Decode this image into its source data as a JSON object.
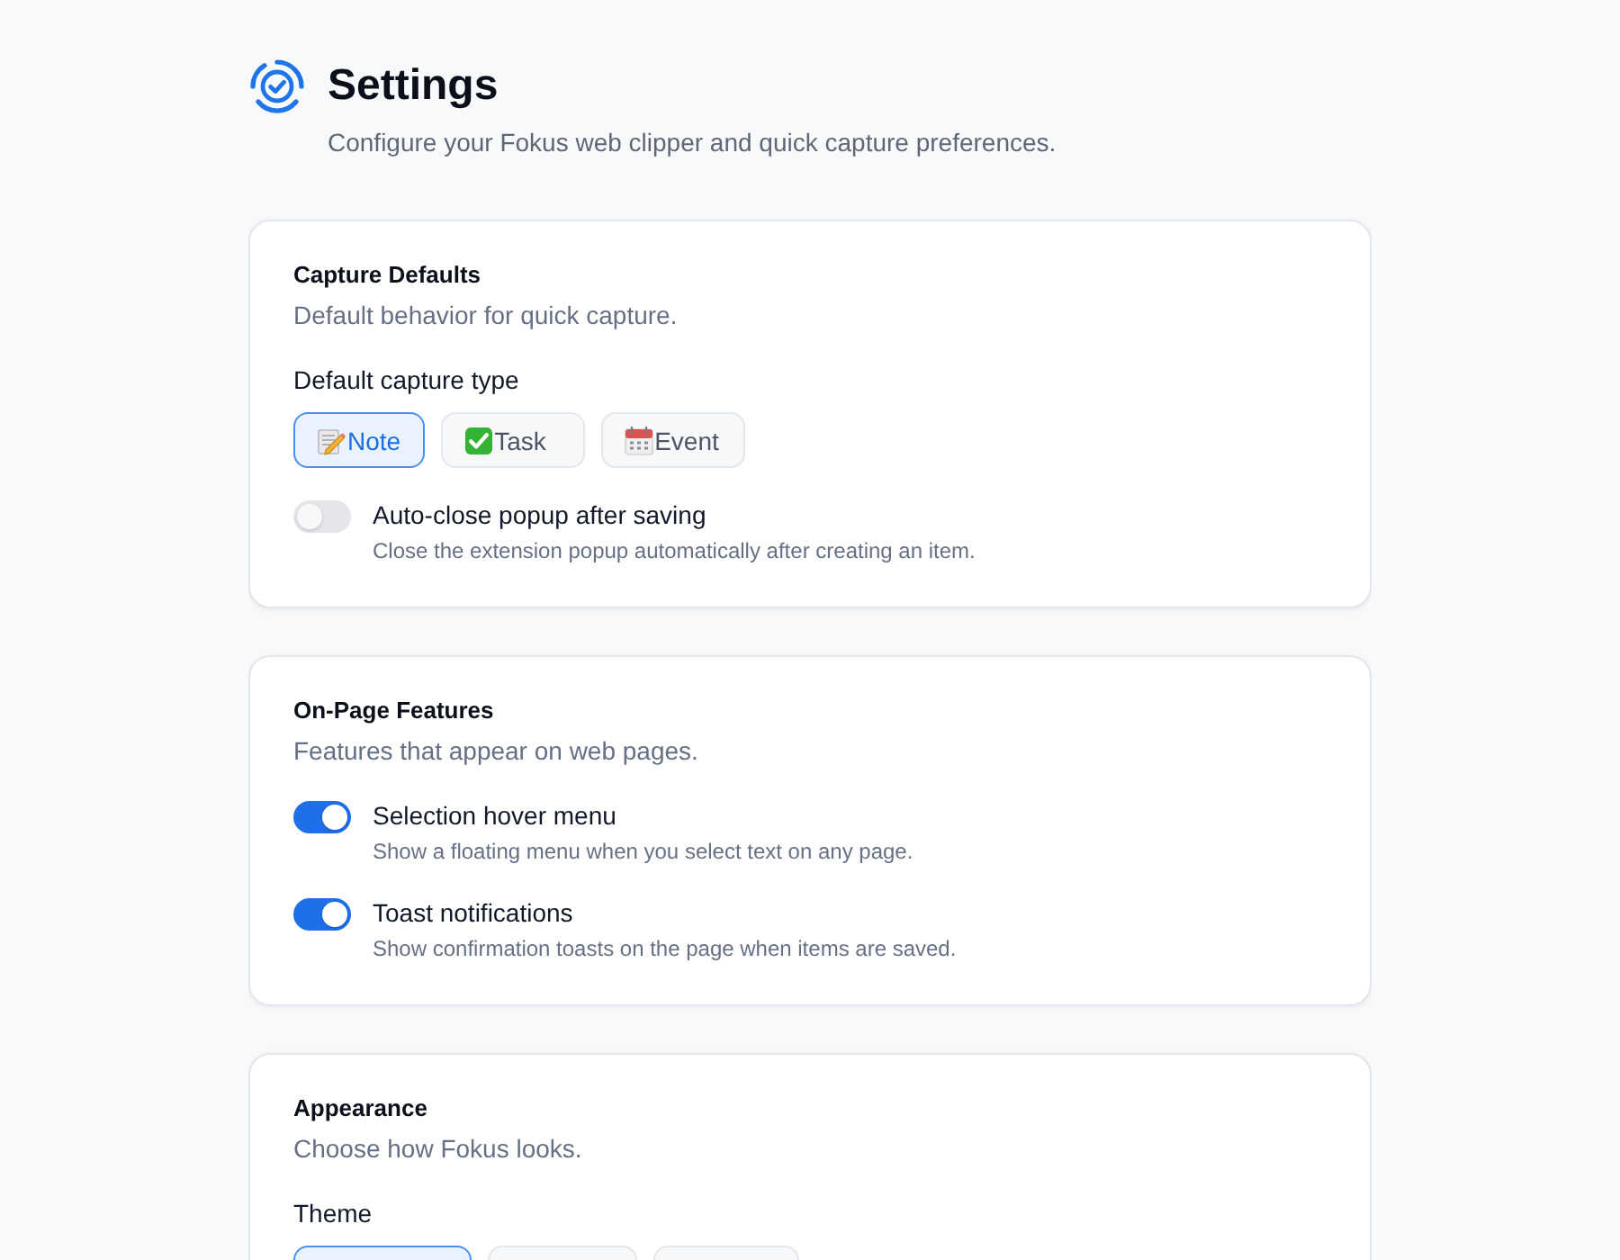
{
  "header": {
    "title": "Settings",
    "subtitle": "Configure your Fokus web clipper and quick capture preferences."
  },
  "sections": [
    {
      "title": "Capture Defaults",
      "description": "Default behavior for quick capture.",
      "choice": {
        "label": "Default capture type",
        "options": [
          {
            "kind": "note",
            "label": "Note",
            "selected": true
          },
          {
            "kind": "task",
            "label": "Task",
            "selected": false
          },
          {
            "kind": "event",
            "label": "Event",
            "selected": false
          }
        ]
      },
      "toggles": [
        {
          "label": "Auto-close popup after saving",
          "description": "Close the extension popup automatically after creating an item.",
          "on": false
        }
      ]
    },
    {
      "title": "On-Page Features",
      "description": "Features that appear on web pages.",
      "toggles": [
        {
          "label": "Selection hover menu",
          "description": "Show a floating menu when you select text on any page.",
          "on": true
        },
        {
          "label": "Toast notifications",
          "description": "Show confirmation toasts on the page when items are saved.",
          "on": true
        }
      ]
    },
    {
      "title": "Appearance",
      "description": "Choose how Fokus looks.",
      "choice": {
        "label": "Theme",
        "options": [
          {
            "selected": true
          },
          {
            "selected": false
          },
          {
            "selected": false
          }
        ]
      }
    }
  ]
}
